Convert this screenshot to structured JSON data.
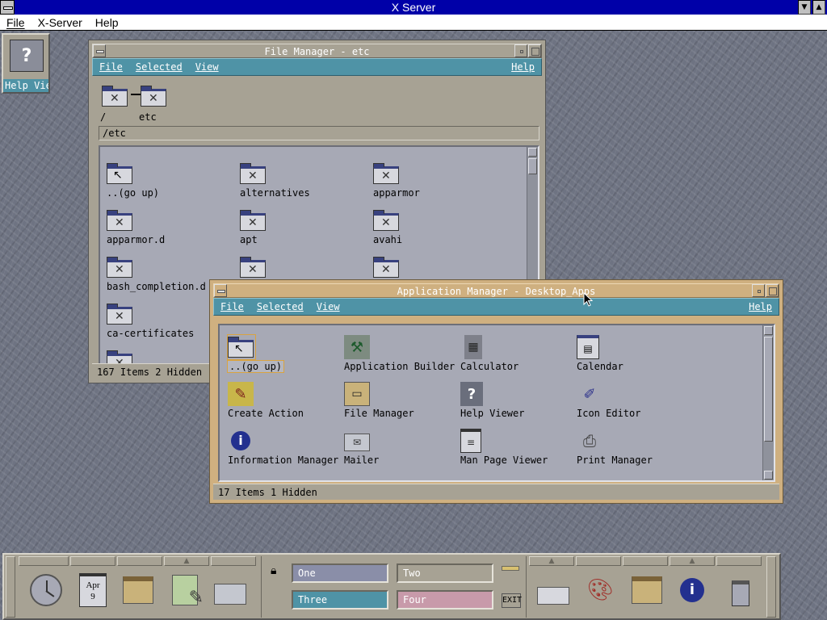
{
  "xserver": {
    "title": "X Server",
    "menu": [
      "File",
      "X-Server",
      "Help"
    ]
  },
  "help_icon": {
    "label": "Help Vie"
  },
  "file_manager": {
    "title": "File Manager - etc",
    "menu": {
      "file": "File",
      "selected": "Selected",
      "view": "View",
      "help": "Help"
    },
    "path_parts": [
      "/",
      "etc"
    ],
    "path_field": "/etc",
    "items": [
      {
        "label": "..(go up)",
        "kind": "up"
      },
      {
        "label": "alternatives",
        "kind": "folder"
      },
      {
        "label": "apparmor",
        "kind": "folder"
      },
      {
        "label": "apparmor.d",
        "kind": "folder"
      },
      {
        "label": "apt",
        "kind": "folder"
      },
      {
        "label": "avahi",
        "kind": "folder"
      },
      {
        "label": "bash_completion.d",
        "kind": "folder"
      },
      {
        "label": "",
        "kind": "folder"
      },
      {
        "label": "",
        "kind": "folder"
      },
      {
        "label": "ca-certificates",
        "kind": "folder"
      }
    ],
    "status": "167 Items 2 Hidden"
  },
  "app_manager": {
    "title": "Application Manager - Desktop_Apps",
    "menu": {
      "file": "File",
      "selected": "Selected",
      "view": "View",
      "help": "Help"
    },
    "items": [
      {
        "label": "..(go up)",
        "icon": "go-up-folder-icon"
      },
      {
        "label": "Application Builder",
        "icon": "app-builder-icon"
      },
      {
        "label": "Calculator",
        "icon": "calculator-icon"
      },
      {
        "label": "Calendar",
        "icon": "calendar-icon"
      },
      {
        "label": "Create Action",
        "icon": "create-action-icon"
      },
      {
        "label": "File Manager",
        "icon": "file-manager-icon"
      },
      {
        "label": "Help Viewer",
        "icon": "help-viewer-icon"
      },
      {
        "label": "Icon Editor",
        "icon": "icon-editor-icon"
      },
      {
        "label": "Information Manager",
        "icon": "info-manager-icon"
      },
      {
        "label": "Mailer",
        "icon": "mailer-icon"
      },
      {
        "label": "Man Page Viewer",
        "icon": "man-page-icon"
      },
      {
        "label": "Print Manager",
        "icon": "print-manager-icon"
      }
    ],
    "status": "17 Items 1 Hidden"
  },
  "front_panel": {
    "calendar": {
      "month": "Apr",
      "day": "9"
    },
    "workspaces": [
      {
        "label": "One",
        "color": "#8a8ea8"
      },
      {
        "label": "Two",
        "color": "#a7a294"
      },
      {
        "label": "Three",
        "color": "#4f93a6"
      },
      {
        "label": "Four",
        "color": "#c89aaa"
      }
    ],
    "exit_label": "EXIT"
  },
  "colors": {
    "titlebar_blue": "#0000a8",
    "cde_menubar": "#4f93a6",
    "cde_frame": "#a7a294",
    "cde_active_frame": "#cfb080",
    "icon_view_bg": "#a7a9b5"
  }
}
